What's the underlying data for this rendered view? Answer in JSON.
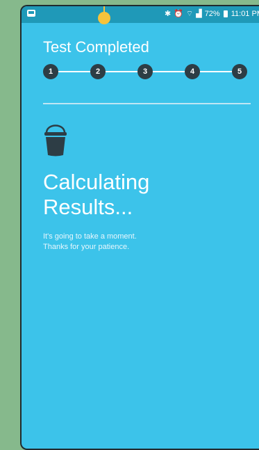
{
  "status_bar": {
    "battery": "72%",
    "time": "11:01 PM",
    "icons": [
      "bluetooth-icon",
      "alarm-icon",
      "wifi-icon",
      "signal-icon"
    ]
  },
  "test": {
    "title": "Test Completed",
    "steps": [
      "1",
      "2",
      "3",
      "4",
      "5"
    ]
  },
  "result": {
    "heading_line1": "Calculating",
    "heading_line2": "Results...",
    "message_line1": "It's going to take a moment.",
    "message_line2": "Thanks for your patience."
  },
  "colors": {
    "screen_bg": "#3cc3ea",
    "status_bar": "#1f99b8",
    "step_circle": "#2d3d45",
    "outer_bg": "#86b98c",
    "marker": "#f6c33b"
  }
}
